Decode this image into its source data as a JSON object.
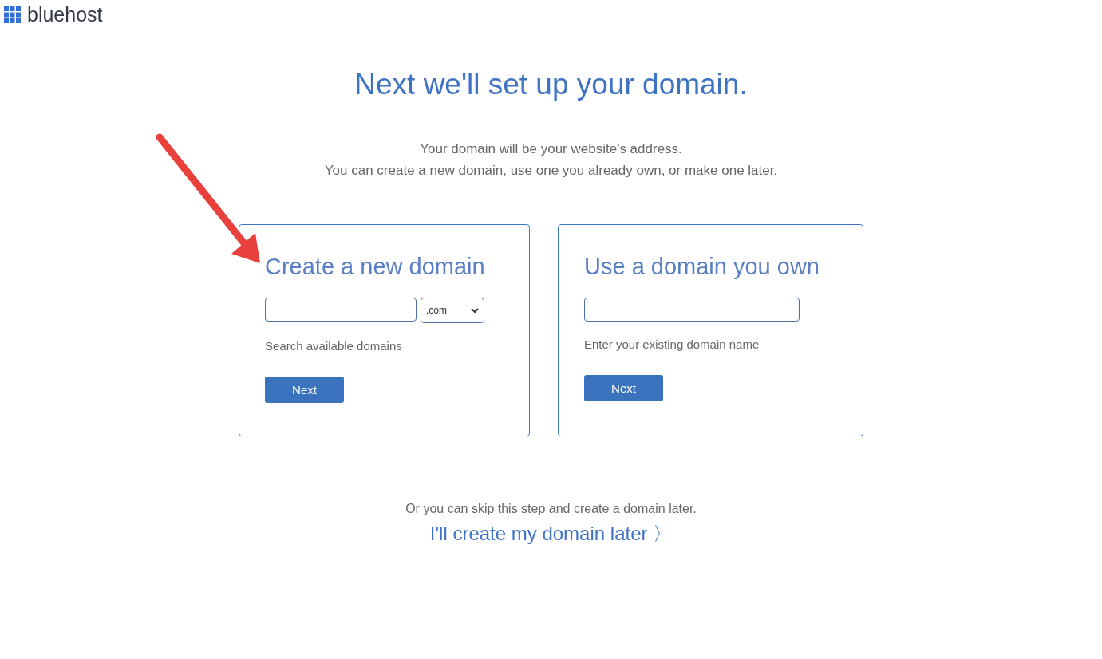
{
  "header": {
    "logo_text": "bluehost"
  },
  "heading": "Next we'll set up your domain.",
  "intro": [
    "Your domain will be your website's address.",
    "You can create a new domain, use one you already own, or make one later."
  ],
  "cards": [
    {
      "kind": "search",
      "title": "Create a new domain",
      "select_value": ".com",
      "hint": "Search available domains",
      "button": "Next"
    },
    {
      "kind": "existing",
      "title": "Use a domain you own",
      "hint": "Enter your existing domain name",
      "button": "Next"
    }
  ],
  "skip": {
    "text": "Or you can skip this step and create a domain later.",
    "link": "I'll create my domain later",
    "chevron": "〉"
  }
}
